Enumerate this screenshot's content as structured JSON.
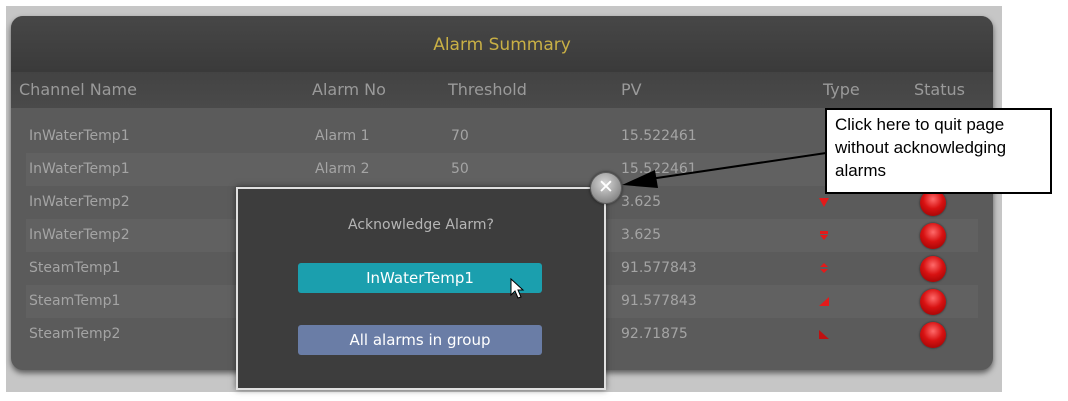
{
  "panel": {
    "title": "Alarm Summary"
  },
  "table": {
    "columns": [
      "Channel Name",
      "Alarm No",
      "Threshold",
      "PV",
      "Type",
      "Status"
    ],
    "rows": [
      {
        "channel": "InWaterTemp1",
        "alarm_no": "Alarm 1",
        "threshold": "70",
        "pv": "15.522461",
        "type_icon": "",
        "status": ""
      },
      {
        "channel": "InWaterTemp1",
        "alarm_no": "Alarm 2",
        "threshold": "50",
        "pv": "15.522461",
        "type_icon": "",
        "status": ""
      },
      {
        "channel": "InWaterTemp2",
        "alarm_no": "",
        "threshold": "",
        "pv": "3.625",
        "type_icon": "triangle-down-icon",
        "status": "red"
      },
      {
        "channel": "InWaterTemp2",
        "alarm_no": "",
        "threshold": "",
        "pv": "3.625",
        "type_icon": "deviation-low-icon",
        "status": "red"
      },
      {
        "channel": "SteamTemp1",
        "alarm_no": "",
        "threshold": "",
        "pv": "91.577843",
        "type_icon": "deviation-band-icon",
        "status": "red"
      },
      {
        "channel": "SteamTemp1",
        "alarm_no": "",
        "threshold": "",
        "pv": "91.577843",
        "type_icon": "rate-rise-icon",
        "status": "red"
      },
      {
        "channel": "SteamTemp2",
        "alarm_no": "",
        "threshold": "",
        "pv": "92.71875",
        "type_icon": "rate-fall-icon",
        "status": "red"
      }
    ]
  },
  "dialog": {
    "title": "Acknowledge Alarm?",
    "primary_button": "InWaterTemp1",
    "secondary_button": "All alarms in group"
  },
  "close_button": {
    "icon": "close-icon"
  },
  "callout": {
    "lines": [
      "Click here to quit page",
      "without acknowledging",
      "alarms"
    ]
  },
  "colors": {
    "panel_title": "#c9b045",
    "primary_button": "#1b9fae",
    "secondary_button": "#6a7da6",
    "status_alarm": "#d81212"
  }
}
